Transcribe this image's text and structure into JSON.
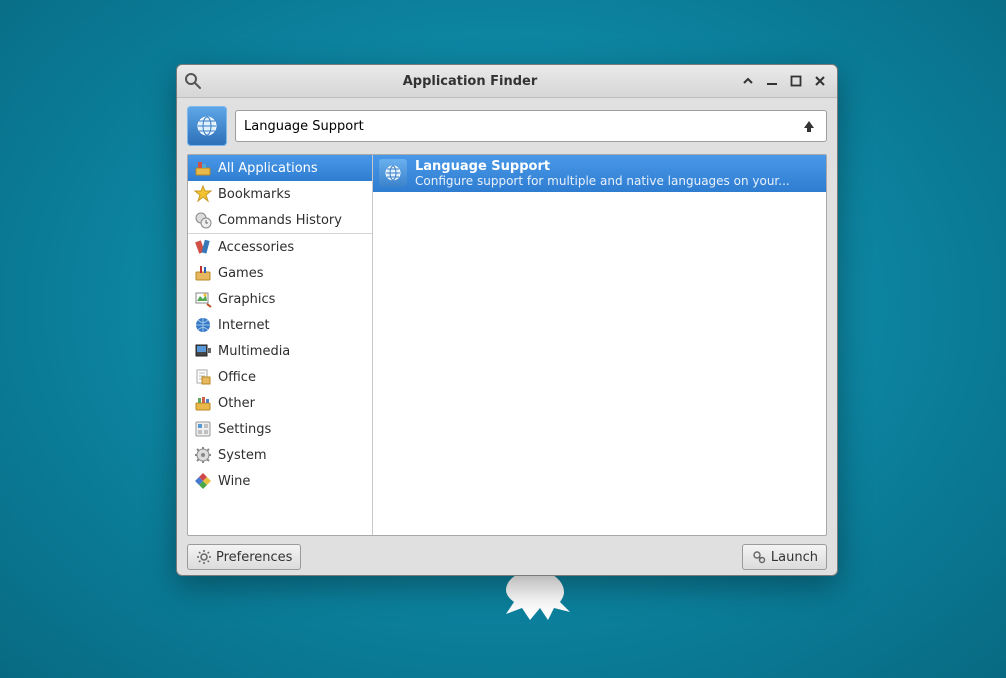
{
  "window": {
    "title": "Application Finder"
  },
  "search": {
    "value": "Language Support"
  },
  "categories": {
    "items": [
      {
        "label": "All Applications",
        "icon": "applications-icon",
        "selected": true
      },
      {
        "label": "Bookmarks",
        "icon": "star-icon"
      },
      {
        "label": "Commands History",
        "icon": "history-icon"
      },
      {
        "label": "Accessories",
        "icon": "accessories-icon",
        "divider_before": true
      },
      {
        "label": "Games",
        "icon": "games-icon"
      },
      {
        "label": "Graphics",
        "icon": "graphics-icon"
      },
      {
        "label": "Internet",
        "icon": "internet-icon"
      },
      {
        "label": "Multimedia",
        "icon": "multimedia-icon"
      },
      {
        "label": "Office",
        "icon": "office-icon"
      },
      {
        "label": "Other",
        "icon": "other-icon"
      },
      {
        "label": "Settings",
        "icon": "settings-icon"
      },
      {
        "label": "System",
        "icon": "system-icon"
      },
      {
        "label": "Wine",
        "icon": "wine-icon"
      }
    ]
  },
  "results": {
    "items": [
      {
        "title": "Language Support",
        "subtitle": "Configure support for multiple and native languages on your...",
        "icon": "language-icon"
      }
    ]
  },
  "footer": {
    "preferences_label": "Preferences",
    "launch_label": "Launch"
  }
}
